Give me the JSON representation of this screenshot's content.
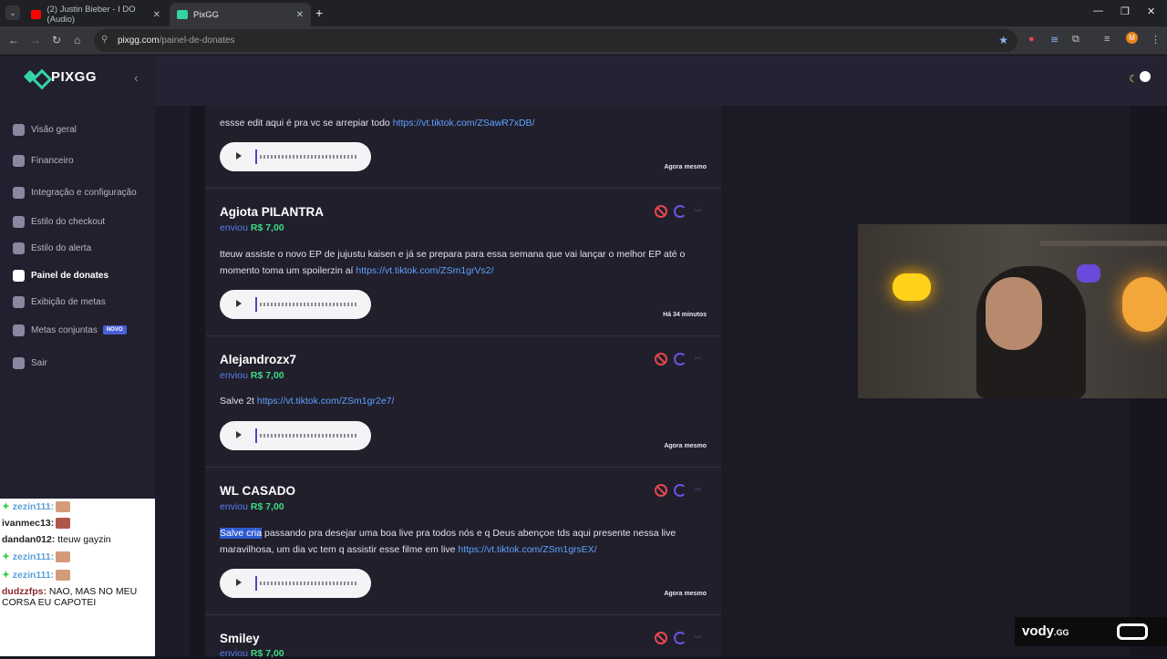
{
  "browser": {
    "tabs": [
      {
        "title": "(2) Justin Bieber - I DO (Audio)",
        "favicon_color": "#ff0000"
      },
      {
        "title": "PixGG",
        "favicon_color": "#35d3a6"
      }
    ],
    "url_domain": "pixgg.com",
    "url_path": "/painel-de-donates",
    "profile_initial": "M"
  },
  "sidebar": {
    "brand": "PIXGG",
    "items": [
      {
        "label": "Visão geral",
        "icon": "home-icon"
      },
      {
        "label": "Financeiro",
        "icon": "wallet-icon"
      },
      {
        "label": "Integração e configuração",
        "icon": "document-icon"
      },
      {
        "label": "Estilo do checkout",
        "icon": "palette-icon"
      },
      {
        "label": "Estilo do alerta",
        "icon": "palette-icon"
      },
      {
        "label": "Painel de donates",
        "icon": "hand-coin-icon"
      },
      {
        "label": "Exibição de metas",
        "icon": "star-icon"
      },
      {
        "label": "Metas conjuntas",
        "icon": "target-icon",
        "badge": "NOVO"
      },
      {
        "label": "Sair",
        "icon": "logout-icon"
      }
    ]
  },
  "donations": {
    "sent_label": "enviou",
    "items": [
      {
        "name": "",
        "amount": "",
        "message": "essse edit aqui é pra vc se arrepiar todo ",
        "link": "https://vt.tiktok.com/ZSawR7xDB/",
        "time": "Agora mesmo"
      },
      {
        "name": "Agiota PILANTRA",
        "amount": "R$ 7,00",
        "message": "tteuw assiste o novo EP de jujustu kaisen e já se prepara para essa semana que vai lançar o melhor EP até o momento toma um spoilerzin aí ",
        "link": "https://vt.tiktok.com/ZSm1grVs2/",
        "time": "Há 34 minutos"
      },
      {
        "name": "Alejandrozx7",
        "amount": "R$ 7,00",
        "message": "Salve 2t ",
        "link": "https://vt.tiktok.com/ZSm1gr2e7/",
        "time": "Agora mesmo"
      },
      {
        "name": "WL CASADO",
        "amount": "R$ 7,00",
        "message_highlight": "Salve cria",
        "message": " passando pra desejar uma boa live pra todos nós e q Deus abençoe tds aqui presente nessa live maravilhosa, um dia vc tem q assistir esse filme em live ",
        "link": "https://vt.tiktok.com/ZSm1grsEX/",
        "time": "Agora mesmo"
      },
      {
        "name": "Smiley",
        "amount": "R$ 7,00",
        "message": "",
        "link": "",
        "time": ""
      }
    ]
  },
  "chat": [
    {
      "user": "zezin111:",
      "message": ""
    },
    {
      "user": "ivanmec13:",
      "message": ""
    },
    {
      "user": "dandan012:",
      "message": "tteuw gayzin"
    },
    {
      "user": "zezin111:",
      "message": ""
    },
    {
      "user": "zezin111:",
      "message": ""
    },
    {
      "user": "dudzzfps:",
      "message": "NAO, MAS NO MEU CORSA EU CAPOTEI"
    }
  ],
  "watermark": {
    "text": "vody",
    "suffix": ".GG"
  },
  "colors": {
    "accent_green": "#35d3a6",
    "amount_green": "#3ddc84",
    "link_blue": "#5ea2ff",
    "ban_red": "#e5484d",
    "badge_blue": "#4a5ed8"
  }
}
